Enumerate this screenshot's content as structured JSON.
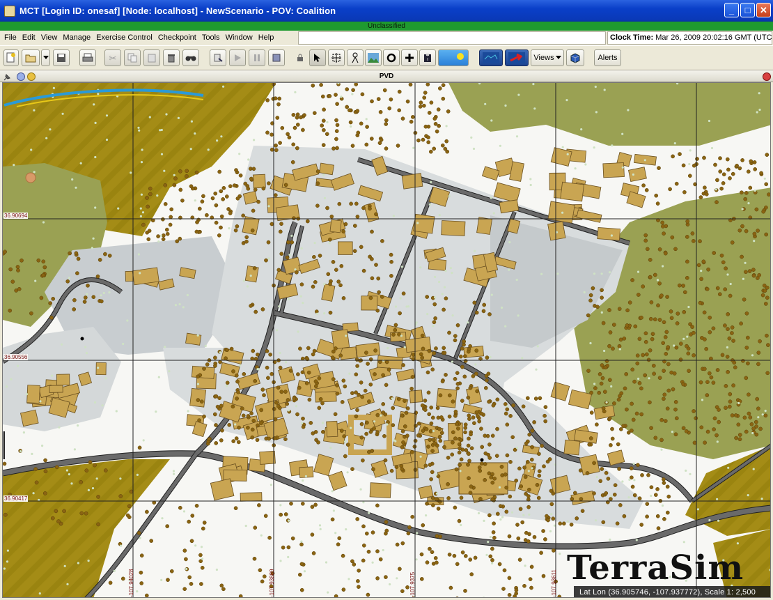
{
  "window": {
    "title": "MCT   [Login ID:  onesaf] [Node:  localhost] - NewScenario - POV: Coalition",
    "classification": "Unclassified"
  },
  "menu": {
    "items": [
      "File",
      "Edit",
      "View",
      "Manage",
      "Exercise Control",
      "Checkpoint",
      "Tools",
      "Window",
      "Help"
    ]
  },
  "clock": {
    "label": "Clock Time:",
    "value": "Mar 26, 2009 20:02:16 GMT (UTC)"
  },
  "toolbar": {
    "views_label": "Views",
    "alerts_label": "Alerts",
    "icons": [
      "new-scenario-icon",
      "open-icon",
      "dropdown-arrow-icon",
      "save-icon",
      "print-icon",
      "cut-icon",
      "copy-icon",
      "paste-icon",
      "delete-icon",
      "find-icon",
      "step-icon",
      "play-icon",
      "pause-icon",
      "stop-icon",
      "lock-icon",
      "select-pointer-icon",
      "pan-icon",
      "unit-icon",
      "terrain-icon",
      "rotate-icon",
      "add-icon",
      "clipboard-icon",
      "sky-icon",
      "map-globe-icon",
      "route-arrow-icon",
      "cube-icon"
    ]
  },
  "panel": {
    "title": "PVD"
  },
  "map": {
    "lat_labels": [
      "36.90694",
      "36.90556",
      "36.90417"
    ],
    "lon_labels": [
      "-107.94028",
      "-107.93889",
      "-107.9375",
      "-107.93611"
    ],
    "logo_text": "TerraSim",
    "status": "Lat Lon (36.905746, -107.937772), Scale 1: 2,500"
  },
  "colors": {
    "title_bar": "#0a3fc8",
    "classification": "#1f9a2f",
    "building": "#c9a552",
    "tree": "#8a6412",
    "vegetation": "#9aa153",
    "road": "#555555",
    "pavement": "#c8cdd0",
    "farm": "#a08a18"
  }
}
